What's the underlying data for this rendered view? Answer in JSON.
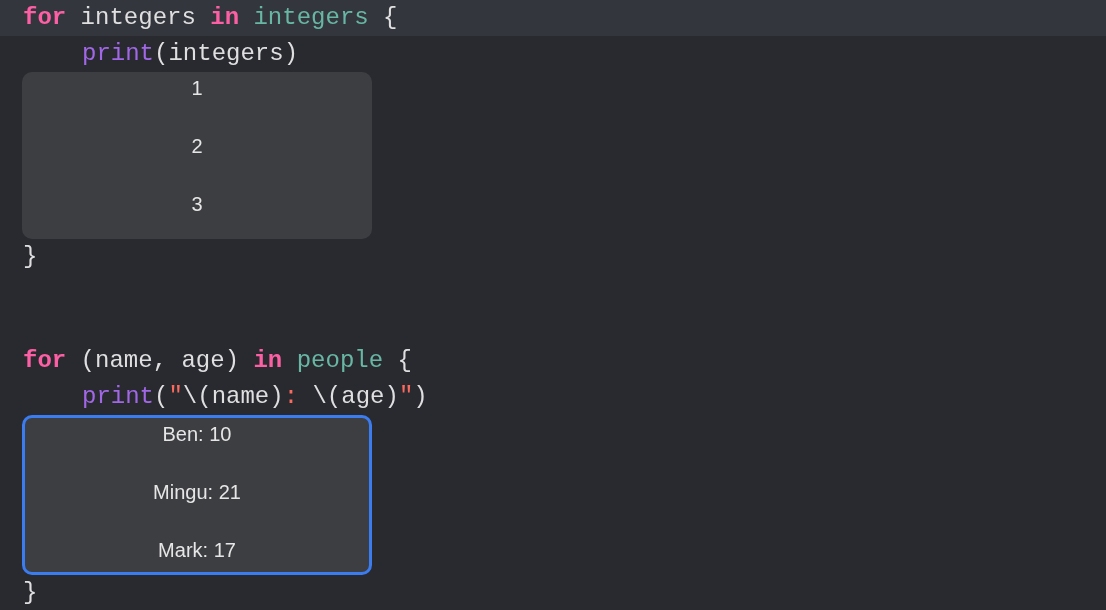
{
  "blocks": [
    {
      "header": {
        "highlighted": true,
        "tokens": [
          {
            "text": "for",
            "kind": "keyword"
          },
          {
            "text": " integers ",
            "kind": "plain"
          },
          {
            "text": "in",
            "kind": "keyword"
          },
          {
            "text": " integers",
            "kind": "variable"
          },
          {
            "text": " {",
            "kind": "plain"
          }
        ]
      },
      "body": [
        {
          "kind": "code",
          "tokens": [
            {
              "text": "print",
              "kind": "function"
            },
            {
              "text": "(integers)",
              "kind": "plain"
            }
          ]
        },
        {
          "kind": "result",
          "selected": false,
          "values": [
            "1",
            "2",
            "3"
          ]
        }
      ],
      "closing": "}"
    },
    {
      "header": {
        "highlighted": false,
        "tokens": [
          {
            "text": "for",
            "kind": "keyword"
          },
          {
            "text": " (name, age) ",
            "kind": "plain"
          },
          {
            "text": "in",
            "kind": "keyword"
          },
          {
            "text": " people",
            "kind": "variable"
          },
          {
            "text": " {",
            "kind": "plain"
          }
        ]
      },
      "body": [
        {
          "kind": "code",
          "tokens": [
            {
              "text": "print",
              "kind": "function"
            },
            {
              "text": "(",
              "kind": "plain"
            },
            {
              "text": "\"",
              "kind": "string"
            },
            {
              "text": "\\(name)",
              "kind": "plain"
            },
            {
              "text": ": ",
              "kind": "string"
            },
            {
              "text": "\\(age)",
              "kind": "plain"
            },
            {
              "text": "\"",
              "kind": "string"
            },
            {
              "text": ")",
              "kind": "plain"
            }
          ]
        },
        {
          "kind": "result",
          "selected": true,
          "values": [
            "Ben: 10",
            "Mingu: 21",
            "Mark: 17"
          ]
        }
      ],
      "closing": "}"
    }
  ]
}
